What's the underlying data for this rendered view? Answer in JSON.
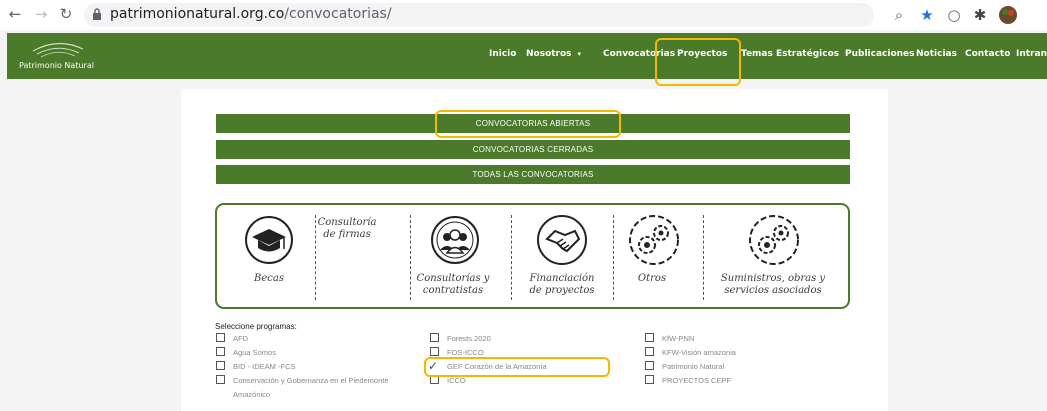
{
  "browser": {
    "url_domain": "patrimonionatural.org.co",
    "url_path": "/convocatorias/"
  },
  "header": {
    "logo_text": "Patrimonio Natural",
    "menu": [
      {
        "label": "Inicio"
      },
      {
        "label": "Nosotros",
        "caret": "▾"
      },
      {
        "label": "Convocatorias"
      },
      {
        "label": "Proyectos"
      },
      {
        "label": "Temas Estratégicos",
        "caret": "▾"
      },
      {
        "label": "Publicaciones"
      },
      {
        "label": "Noticias"
      },
      {
        "label": "Contacto"
      },
      {
        "label": "Intrane"
      }
    ]
  },
  "filters": {
    "open": "CONVOCATORIAS ABIERTAS",
    "closed": "CONVOCATORIAS CERRADAS",
    "all": "TODAS LAS CONVOCATORIAS"
  },
  "categories": [
    {
      "label1": "Becas",
      "label2": "",
      "icon": "graduation-cap-icon"
    },
    {
      "label1": "Consultoría",
      "label2": "de firmas",
      "icon": ""
    },
    {
      "label1": "Consultorías y",
      "label2": "contratistas",
      "icon": "people-icon"
    },
    {
      "label1": "Financiación",
      "label2": "de proyectos",
      "icon": "handshake-icon"
    },
    {
      "label1": "Otros",
      "label2": "",
      "icon": "gears-icon"
    },
    {
      "label1": "Suministros, obras y",
      "label2": "servicios asociados",
      "icon": "gears-icon"
    }
  ],
  "programs": {
    "title": "Seleccione programas:",
    "col1": [
      "AFD",
      "Agua Somos",
      "BID - IDEAM -FCS",
      "Conservación y Gobernanza en el Piedemonte",
      "Amazónico"
    ],
    "col2": [
      "Forests 2020",
      "FOS-ICCO",
      "GEF Corazón de la Amazonía",
      "ICCO"
    ],
    "col3": [
      "KfW-PNN",
      "KFW-Visión amazonia",
      "Patrimonio Natural",
      "PROYECTOS CEPF"
    ],
    "checked": "GEF Corazón de la Amazonía"
  },
  "colors": {
    "brand_green": "#4a7a2a",
    "highlight": "#f5b800"
  }
}
